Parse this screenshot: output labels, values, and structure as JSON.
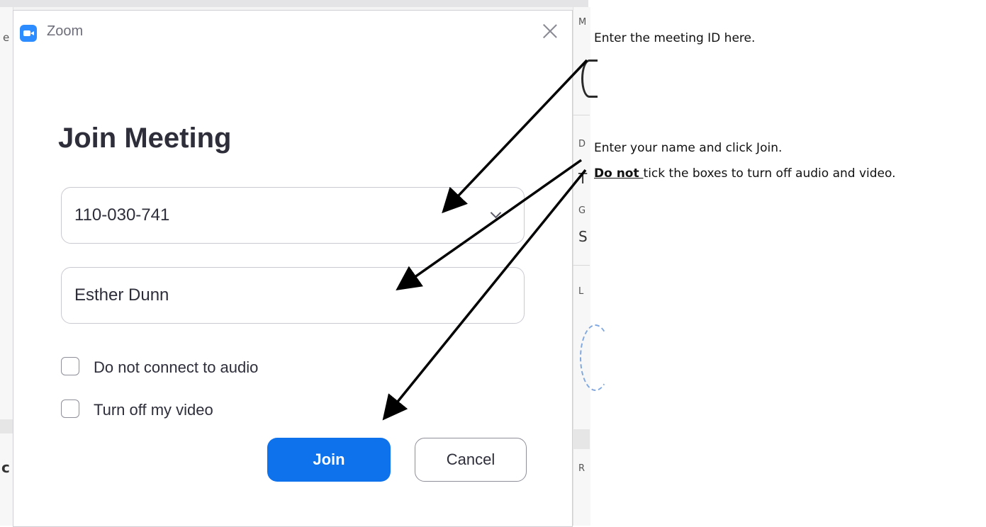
{
  "dialog": {
    "app_title": "Zoom",
    "heading": "Join Meeting",
    "meeting_id_value": "110-030-741",
    "name_value": "Esther Dunn",
    "option_audio": "Do not connect to audio",
    "option_video": "Turn off my video",
    "join_label": "Join",
    "cancel_label": "Cancel"
  },
  "annotations": {
    "note_meeting_id": "Enter the meeting ID here.",
    "note_name": "Enter your name and click Join.",
    "note_boxes_emphasis": "Do not ",
    "note_boxes_rest": "tick the boxes to turn off audio and video."
  },
  "background": {
    "letters": [
      "e",
      "M",
      "D",
      "T",
      "G",
      "S",
      "L",
      "R",
      "c"
    ]
  },
  "colors": {
    "accent": "#0e72ed",
    "zoom_icon": "#2d8cff"
  }
}
